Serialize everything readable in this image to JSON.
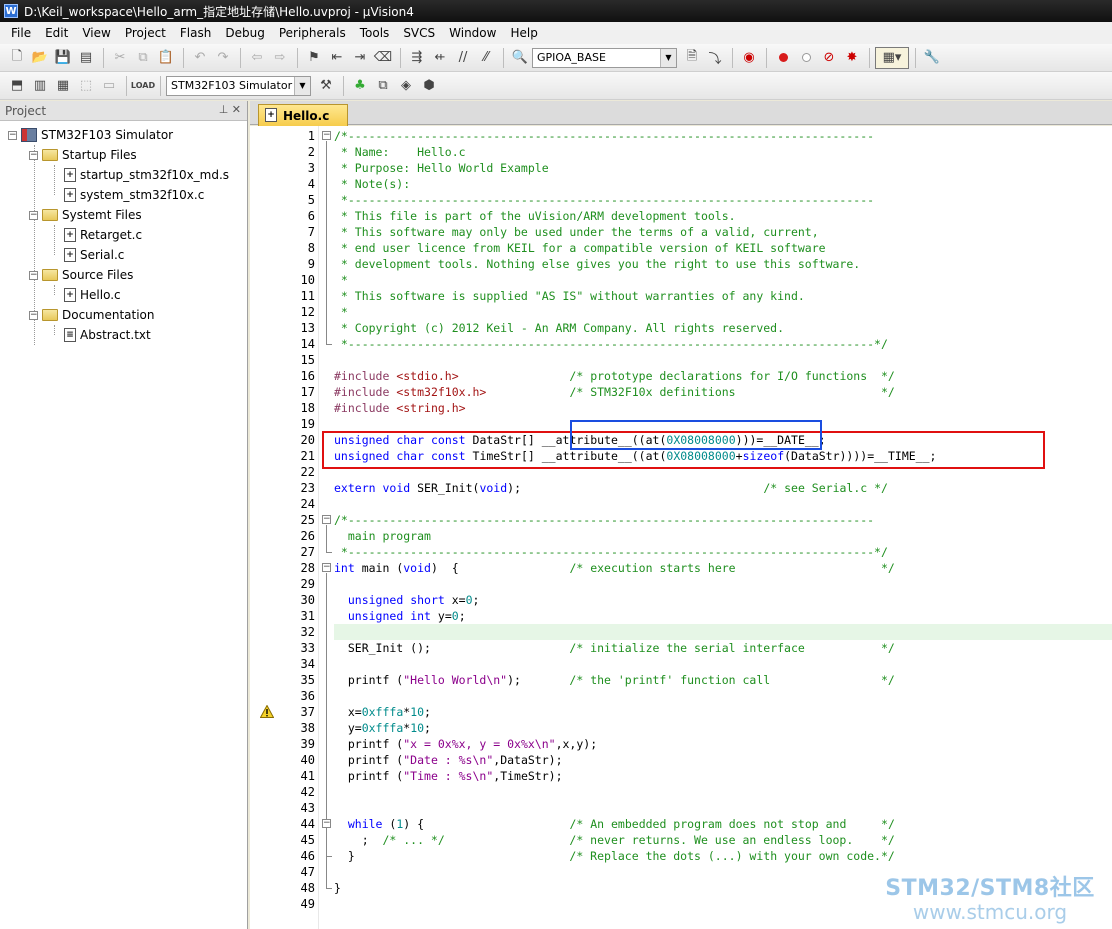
{
  "window": {
    "title": "D:\\Keil_workspace\\Hello_arm_指定地址存储\\Hello.uvproj - µVision4"
  },
  "menu": [
    "File",
    "Edit",
    "View",
    "Project",
    "Flash",
    "Debug",
    "Peripherals",
    "Tools",
    "SVCS",
    "Window",
    "Help"
  ],
  "toolbar1": {
    "find_combo": "GPIOA_BASE"
  },
  "toolbar2": {
    "target_combo": "STM32F103 Simulator"
  },
  "project": {
    "panel_title": "Project",
    "root": "STM32F103 Simulator",
    "groups": [
      {
        "name": "Startup Files",
        "files": [
          "startup_stm32f10x_md.s",
          "system_stm32f10x.c"
        ]
      },
      {
        "name": "Systemt Files",
        "files": [
          "Retarget.c",
          "Serial.c"
        ]
      },
      {
        "name": "Source Files",
        "files": [
          "Hello.c"
        ]
      },
      {
        "name": "Documentation",
        "files": [
          "Abstract.txt"
        ]
      }
    ]
  },
  "editor": {
    "active_tab": "Hello.c",
    "current_line": 32,
    "warning_line": 37,
    "line_numbers": [
      "1",
      "2",
      "3",
      "4",
      "5",
      "6",
      "7",
      "8",
      "9",
      "10",
      "11",
      "12",
      "13",
      "14",
      "15",
      "16",
      "17",
      "18",
      "19",
      "20",
      "21",
      "22",
      "23",
      "24",
      "25",
      "26",
      "27",
      "28",
      "29",
      "30",
      "31",
      "32",
      "33",
      "34",
      "35",
      "36",
      "37",
      "38",
      "39",
      "40",
      "41",
      "42",
      "43",
      "44",
      "45",
      "46",
      "47",
      "48",
      "49"
    ],
    "lines": [
      "/*----------------------------------------------------------------------------",
      " * Name:    Hello.c",
      " * Purpose: Hello World Example",
      " * Note(s):",
      " *----------------------------------------------------------------------------",
      " * This file is part of the uVision/ARM development tools.",
      " * This software may only be used under the terms of a valid, current,",
      " * end user licence from KEIL for a compatible version of KEIL software",
      " * development tools. Nothing else gives you the right to use this software.",
      " *",
      " * This software is supplied \"AS IS\" without warranties of any kind.",
      " *",
      " * Copyright (c) 2012 Keil - An ARM Company. All rights reserved.",
      " *----------------------------------------------------------------------------*/",
      "",
      "#include <stdio.h>                /* prototype declarations for I/O functions  */",
      "#include <stm32f10x.h>            /* STM32F10x definitions                     */",
      "#include <string.h>",
      "",
      "unsigned char const DataStr[] __attribute__((at(0X08008000)))=__DATE__;",
      "unsigned char const TimeStr[] __attribute__((at(0X08008000+sizeof(DataStr))))=__TIME__;",
      "",
      "extern void SER_Init(void);                                   /* see Serial.c */",
      "",
      "/*----------------------------------------------------------------------------",
      "  main program",
      " *----------------------------------------------------------------------------*/",
      "int main (void)  {                /* execution starts here                     */",
      "",
      "  unsigned short x=0;",
      "  unsigned int y=0;",
      "",
      "  SER_Init ();                    /* initialize the serial interface           */",
      "",
      "  printf (\"Hello World\\n\");       /* the 'printf' function call                */",
      "",
      "  x=0xfffa*10;",
      "  y=0xfffa*10;",
      "  printf (\"x = 0x%x, y = 0x%x\\n\",x,y);",
      "  printf (\"Date : %s\\n\",DataStr);",
      "  printf (\"Time : %s\\n\",TimeStr);",
      "",
      "",
      "  while (1) {                     /* An embedded program does not stop and     */",
      "    ;  /* ... */                  /* never returns. We use an endless loop.    */",
      "  }                               /* Replace the dots (...) with your own code.*/",
      "",
      "}",
      ""
    ]
  },
  "watermark": {
    "line1": "STM32/STM8社区",
    "line2": "www.stmcu.org"
  }
}
